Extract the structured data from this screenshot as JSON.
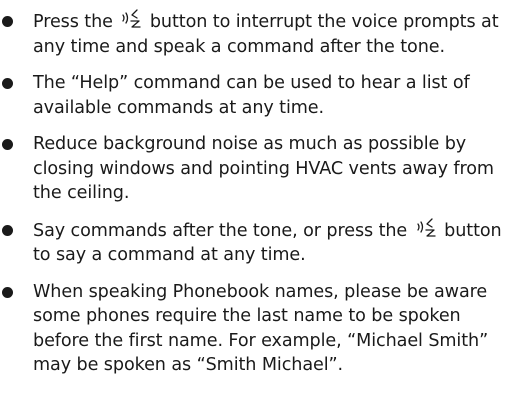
{
  "bullets": [
    {
      "before": "Press the ",
      "icon": "voice-button-icon",
      "after": " button to interrupt the voice prompts at any time and speak a command after the tone."
    },
    {
      "before": "The “Help” command can be used to hear a list of available commands at any time."
    },
    {
      "before": "Reduce background noise as much as possible by closing windows and pointing HVAC vents away from the ceiling."
    },
    {
      "before": "Say commands after the tone, or press the ",
      "icon": "voice-button-icon",
      "after": " button to say a command at any time."
    },
    {
      "before": "When speaking Phonebook names, please be aware some phones require the last name to be spoken before the first name. For example, “Michael Smith” may be spoken as “Smith Michael”."
    }
  ]
}
